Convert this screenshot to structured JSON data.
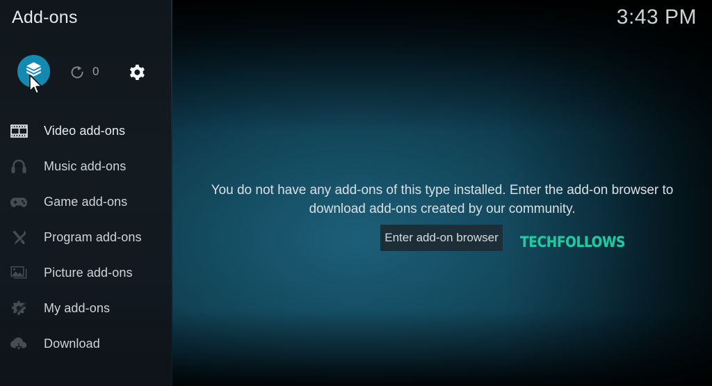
{
  "window": {
    "title": "Add-ons",
    "clock": "3:43 PM"
  },
  "toolbar": {
    "addon_browser_icon": "open-box-icon",
    "refresh_icon": "refresh-icon",
    "refresh_count": "0",
    "settings_icon": "gear-icon"
  },
  "sidebar": {
    "items": [
      {
        "label": "Video add-ons",
        "icon": "film-strip-icon",
        "active": true
      },
      {
        "label": "Music add-ons",
        "icon": "headphones-icon",
        "active": false
      },
      {
        "label": "Game add-ons",
        "icon": "gamepad-icon",
        "active": false
      },
      {
        "label": "Program add-ons",
        "icon": "wrench-pencil-icon",
        "active": false
      },
      {
        "label": "Picture add-ons",
        "icon": "photo-icon",
        "active": false
      },
      {
        "label": "My add-ons",
        "icon": "gear-wrench-icon",
        "active": false
      },
      {
        "label": "Download",
        "icon": "cloud-download-icon",
        "active": false
      }
    ]
  },
  "main": {
    "empty_message": "You do not have any add-ons of this type installed. Enter the add-on browser to download add-ons created by our community.",
    "enter_button_label": "Enter add-on browser",
    "watermark": "TECHFOLLOWS"
  },
  "colors": {
    "accent_teal": "#1489b2",
    "watermark_green": "#21c9a0",
    "sidebar_bg": "#131a20",
    "button_bg": "#1c2f38",
    "text_primary": "#d9e0e4",
    "icon_inactive": "#454d53"
  }
}
